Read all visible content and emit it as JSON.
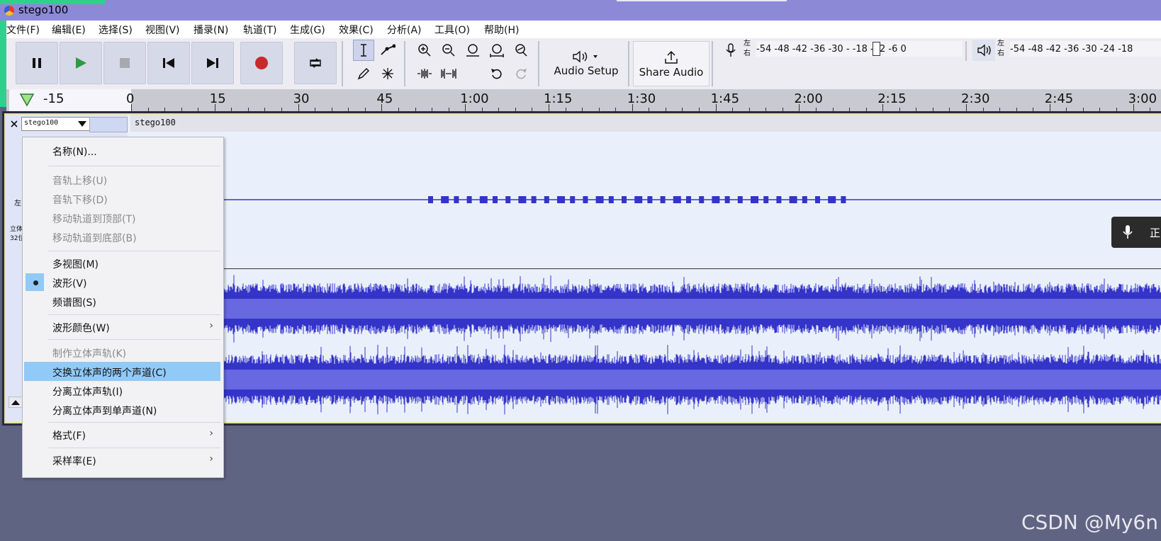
{
  "app": {
    "title": "stego100"
  },
  "menubar": {
    "items": [
      "文件(F)",
      "编辑(E)",
      "选择(S)",
      "视图(V)",
      "播录(N)",
      "轨道(T)",
      "生成(G)",
      "效果(C)",
      "分析(A)",
      "工具(O)",
      "帮助(H)"
    ]
  },
  "toolbar": {
    "audio_setup_label": "Audio Setup",
    "share_audio_label": "Share Audio",
    "record_meter_scale": "-54 -48 -42 -36 -30 -   -18 -12  -6  0",
    "play_meter_scale": "-54 -48 -42 -36 -30 -24 -18",
    "lr_left": "左",
    "lr_right": "右"
  },
  "timeline": {
    "start_label": "-15",
    "labels": [
      "0",
      "15",
      "30",
      "45",
      "1:00",
      "1:15",
      "1:30",
      "1:45",
      "2:00",
      "2:15",
      "2:30",
      "2:45",
      "3:00"
    ]
  },
  "track": {
    "dropdown_name": "stego100",
    "clip_name": "stego100",
    "header_fragments": {
      "a": "左",
      "b": "立体",
      "c": "32位"
    }
  },
  "context_menu": {
    "items": [
      {
        "label": "名称(N)...",
        "disabled": false
      },
      {
        "label": "音轨上移(U)",
        "disabled": true
      },
      {
        "label": "音轨下移(D)",
        "disabled": true
      },
      {
        "label": "移动轨道到顶部(T)",
        "disabled": true
      },
      {
        "label": "移动轨道到底部(B)",
        "disabled": true
      },
      {
        "label": "多视图(M)",
        "disabled": false
      },
      {
        "label": "波形(V)",
        "disabled": false,
        "checked": true
      },
      {
        "label": "频谱图(S)",
        "disabled": false
      },
      {
        "label": "波形颜色(W)",
        "disabled": false,
        "submenu": true
      },
      {
        "label": "制作立体声轨(K)",
        "disabled": true
      },
      {
        "label": "交换立体声的两个声道(C)",
        "disabled": false,
        "highlighted": true
      },
      {
        "label": "分离立体声轨(I)",
        "disabled": false
      },
      {
        "label": "分离立体声到单声道(N)",
        "disabled": false
      },
      {
        "label": "格式(F)",
        "disabled": false,
        "submenu": true
      },
      {
        "label": "采样率(E)",
        "disabled": false,
        "submenu": true
      }
    ]
  },
  "toast": {
    "text": "正"
  },
  "watermark": "CSDN @My6n",
  "colors": {
    "waveform": "#3434c9",
    "waveform_rms": "#6868e0",
    "highlight": "#91c9f7",
    "titlebar": "#8c8ad6"
  }
}
